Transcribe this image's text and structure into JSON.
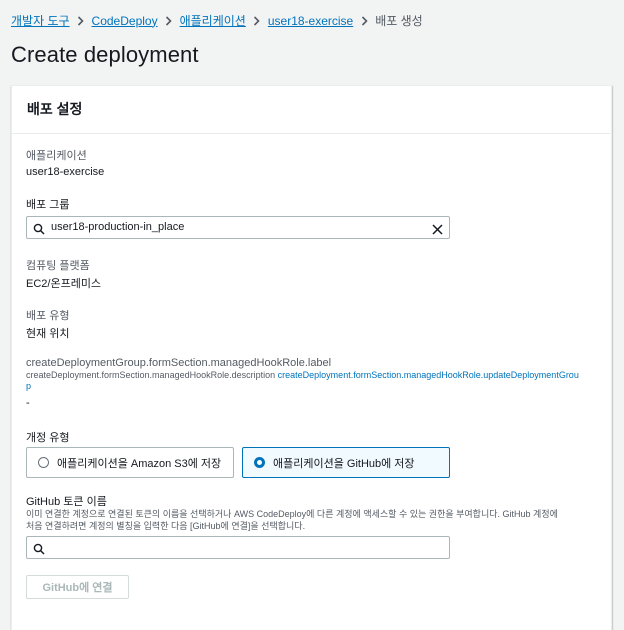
{
  "breadcrumb": {
    "items": [
      "개발자 도구",
      "CodeDeploy",
      "애플리케이션",
      "user18-exercise"
    ],
    "current": "배포 생성"
  },
  "page": {
    "title": "Create deployment"
  },
  "panel": {
    "title": "배포 설정",
    "application": {
      "label": "애플리케이션",
      "value": "user18-exercise"
    },
    "deployment_group": {
      "label": "배포 그룹",
      "value": "user18-production-in_place"
    },
    "compute_platform": {
      "label": "컴퓨팅 플랫폼",
      "value": "EC2/온프레미스"
    },
    "deployment_type": {
      "label": "배포 유형",
      "value": "현재 위치"
    },
    "managed_hook_role": {
      "label": "createDeploymentGroup.formSection.managedHookRole.label",
      "description": "createDeployment.formSection.managedHookRole.description",
      "link_line1": "createDeployment.formSection.managedHookRole.updateDeploymentGrou",
      "link_line2": "p",
      "value": "-"
    },
    "revision_type": {
      "label": "개정 유형",
      "options": [
        "애플리케이션을 Amazon S3에 저장",
        "애플리케이션을 GitHub에 저장"
      ],
      "selected_index": 1
    },
    "github_token": {
      "label": "GitHub 토큰 이름",
      "description_line1": "이미 연결한 계정으로 연결된 토큰의 이름을 선택하거나 AWS CodeDeploy에 다른 계정에 액세스할 수 있는 권한을 부여합니다. GitHub 계정에",
      "description_line2": "처음 연결하려면 계정의 별칭을 입력한 다음 [GitHub에 연결]을 선택합니다.",
      "value": "",
      "connect_label": "GitHub에 연결"
    }
  },
  "colors": {
    "link": "#0073bb",
    "selected_bg": "#f1faff",
    "text": "#16191f"
  }
}
